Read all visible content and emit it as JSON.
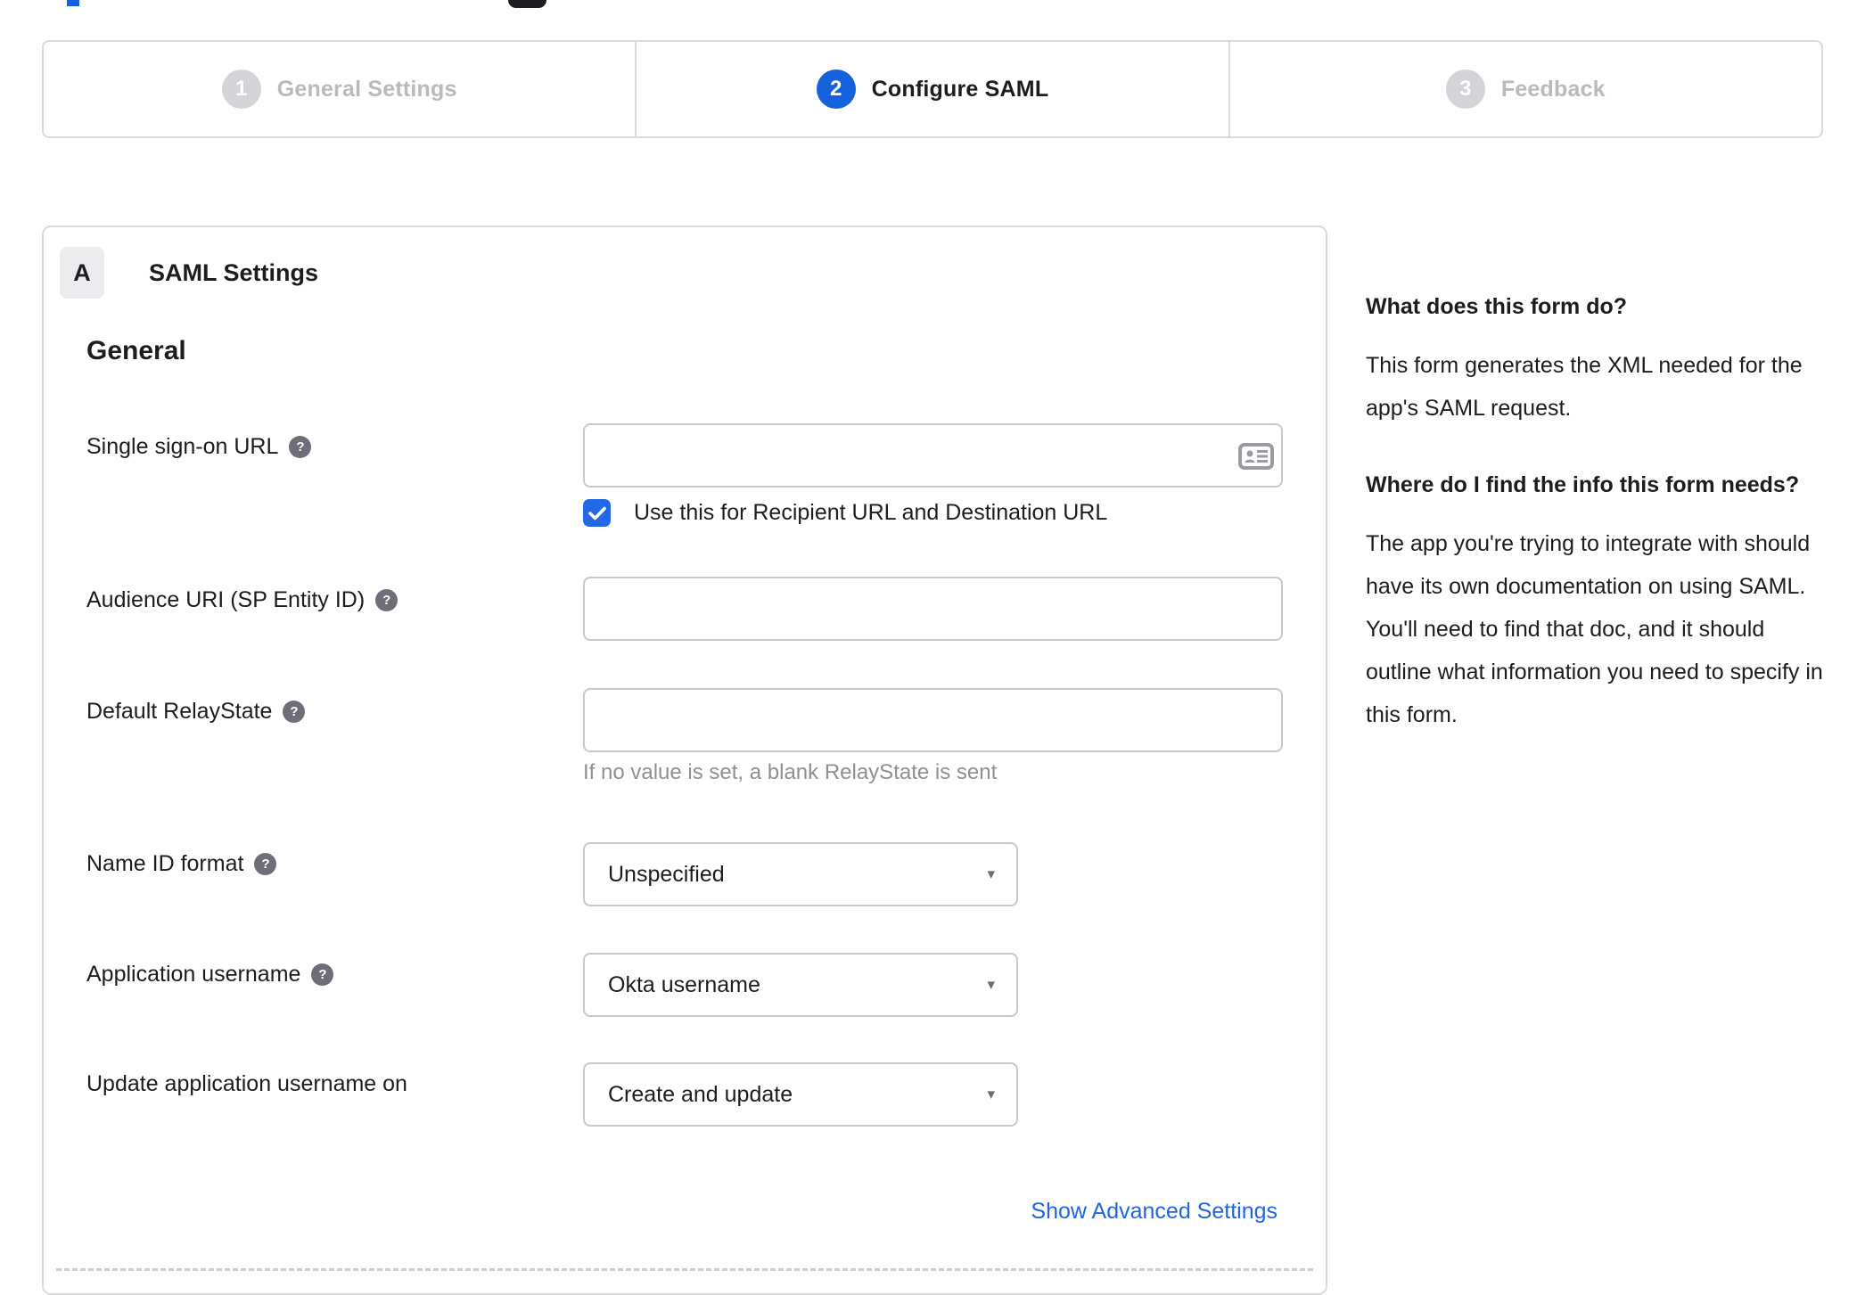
{
  "stepper": {
    "steps": [
      {
        "number": "1",
        "label": "General Settings",
        "state": "inactive"
      },
      {
        "number": "2",
        "label": "Configure SAML",
        "state": "active"
      },
      {
        "number": "3",
        "label": "Feedback",
        "state": "inactive"
      }
    ]
  },
  "panel": {
    "badge": "A",
    "title": "SAML Settings",
    "section_heading": "General",
    "fields": {
      "sso": {
        "label": "Single sign-on URL",
        "value": "",
        "checkbox_label": "Use this for Recipient URL and Destination URL",
        "checkbox_checked": true
      },
      "audience": {
        "label": "Audience URI (SP Entity ID)",
        "value": ""
      },
      "relay": {
        "label": "Default RelayState",
        "value": "",
        "hint": "If no value is set, a blank RelayState is sent"
      },
      "nameid": {
        "label": "Name ID format",
        "value": "Unspecified"
      },
      "appuser": {
        "label": "Application username",
        "value": "Okta username"
      },
      "updateuser": {
        "label": "Update application username on",
        "value": "Create and update"
      }
    },
    "advanced_link": "Show Advanced Settings"
  },
  "sidebar": {
    "q1": "What does this form do?",
    "a1": "This form generates the XML needed for the app's SAML request.",
    "q2": "Where do I find the info this form needs?",
    "a2": "The app you're trying to integrate with should have its own documentation on using SAML. You'll need to find that doc, and it should outline what information you need to specify in this form."
  },
  "icons": {
    "help_glyph": "?",
    "caret_glyph": "▾"
  },
  "colors": {
    "accent_blue": "#1662dd",
    "checkbox_blue": "#2368e4",
    "link_blue": "#2265e0",
    "border_gray": "#dadadd",
    "inactive_gray": "#b9b9be"
  }
}
